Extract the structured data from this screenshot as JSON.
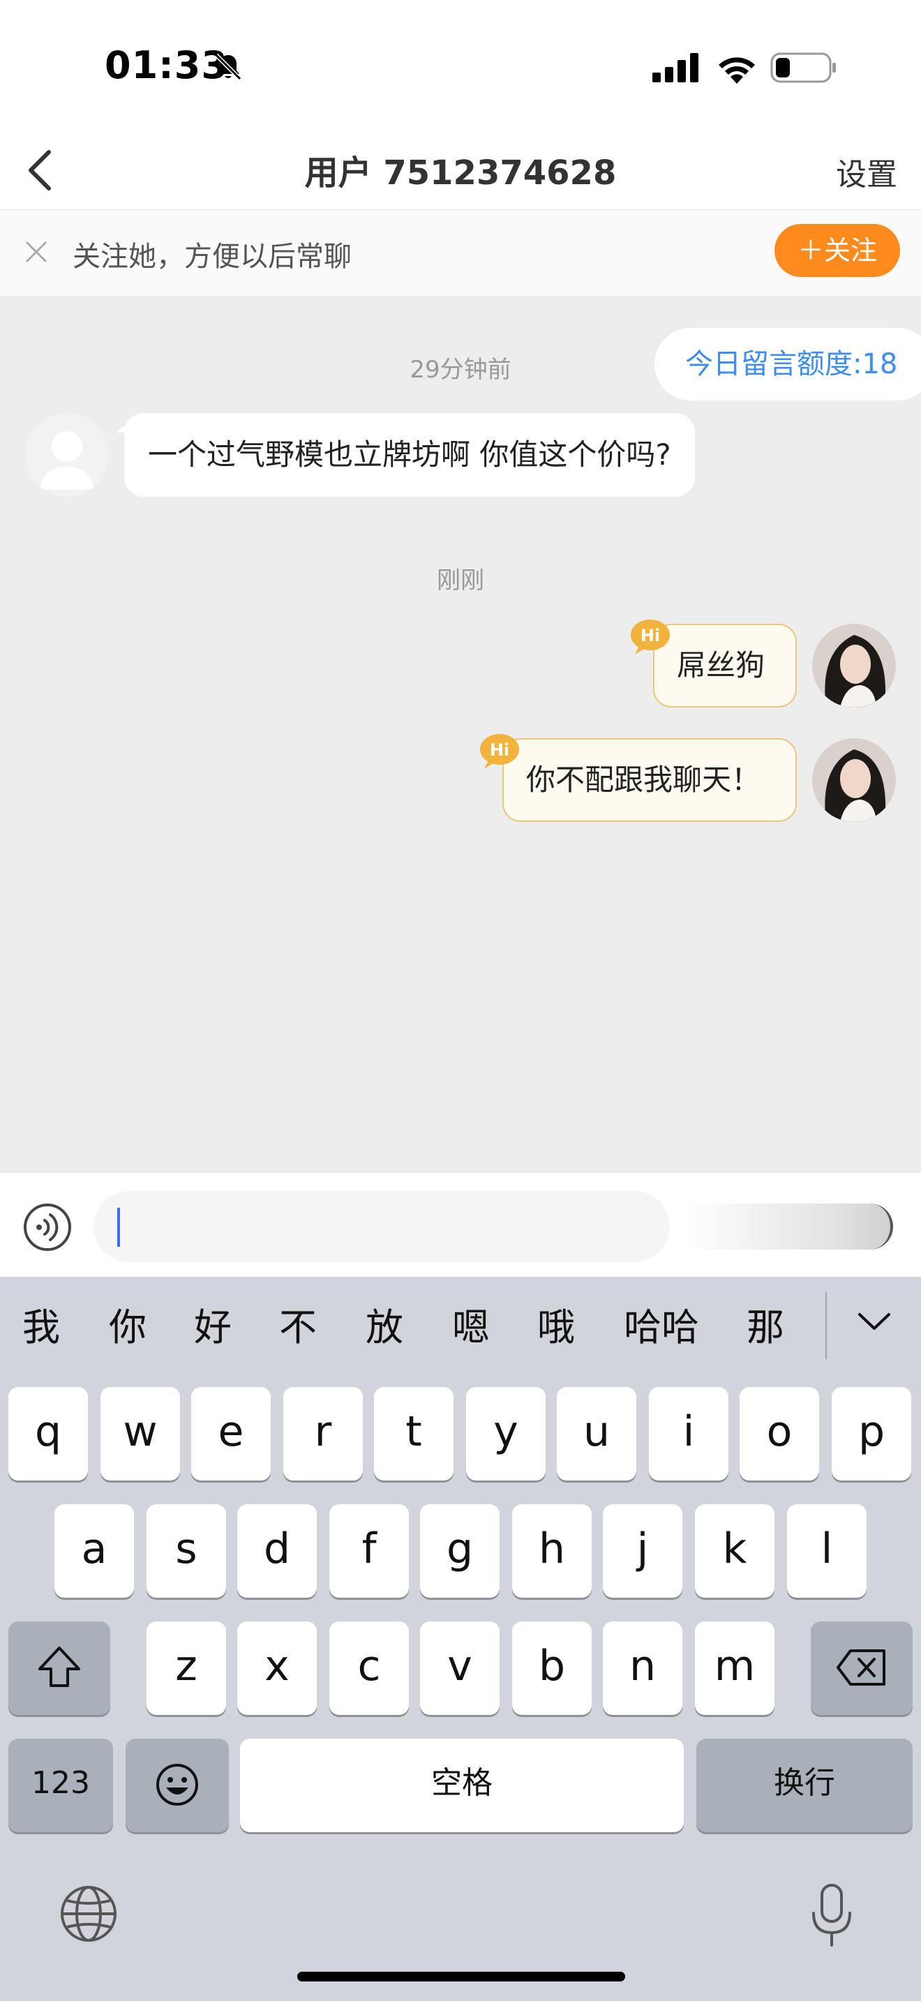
{
  "status_bar": {
    "time": "01:33"
  },
  "nav": {
    "title": "用户 7512374628",
    "settings_label": "设置"
  },
  "follow_bar": {
    "text": "关注她，方便以后常聊",
    "button_label": "＋关注"
  },
  "chat": {
    "quota_label": "今日留言额度:18",
    "timestamp_1": "29分钟前",
    "incoming_message": "一个过气野模也立牌坊啊 你值这个价吗?",
    "timestamp_2": "刚刚",
    "outgoing_messages": [
      "屌丝狗",
      "你不配跟我聊天！"
    ],
    "badge_label": "Hi"
  },
  "input": {
    "placeholder": ""
  },
  "keyboard": {
    "candidates": [
      "我",
      "你",
      "好",
      "不",
      "放",
      "嗯",
      "哦",
      "哈哈",
      "那"
    ],
    "row1": [
      "q",
      "w",
      "e",
      "r",
      "t",
      "y",
      "u",
      "i",
      "o",
      "p"
    ],
    "row2": [
      "a",
      "s",
      "d",
      "f",
      "g",
      "h",
      "j",
      "k",
      "l"
    ],
    "row3": [
      "z",
      "x",
      "c",
      "v",
      "b",
      "n",
      "m"
    ],
    "numbers_label": "123",
    "space_label": "空格",
    "return_label": "换行"
  },
  "colors": {
    "accent_orange": "#ff8a1e",
    "quota_blue": "#3d8ef0",
    "bubble_border": "#e9c77b"
  }
}
